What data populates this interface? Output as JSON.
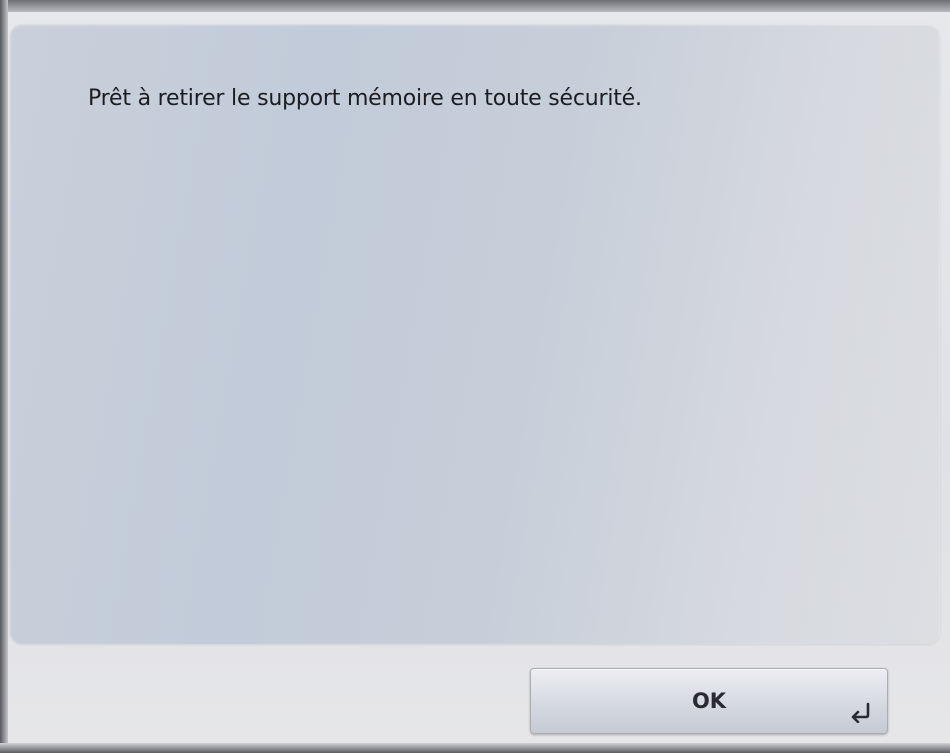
{
  "dialog": {
    "message": "Prêt à retirer le support mémoire en toute sécurité."
  },
  "actions": {
    "ok_label": "OK",
    "ok_icon": "enter-icon"
  }
}
